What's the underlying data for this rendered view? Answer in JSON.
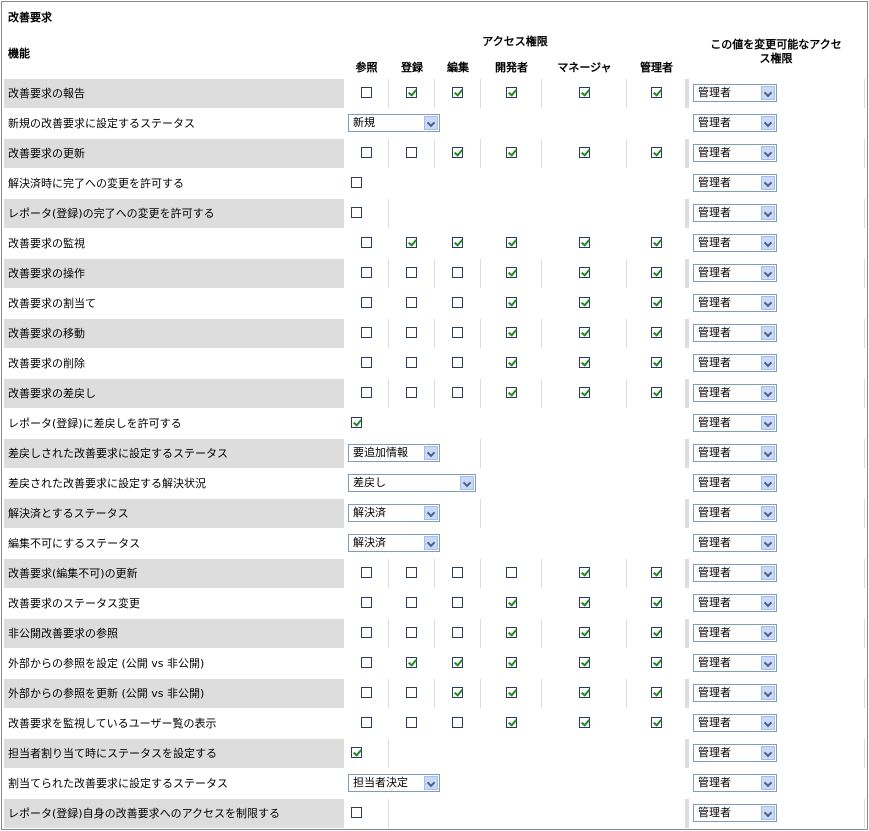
{
  "section_title": "改善要求",
  "headers": {
    "feature": "機能",
    "access": "アクセス権限",
    "change_line1": "この値を変更可能なアクセ",
    "change_line2": "ス権限",
    "roles": [
      "参照",
      "登録",
      "編集",
      "開発者",
      "マネージャ",
      "管理者"
    ]
  },
  "rows": [
    {
      "label": "改善要求の報告",
      "type": "checks",
      "checks": [
        false,
        true,
        true,
        true,
        true,
        true
      ],
      "change": "管理者"
    },
    {
      "label": "新規の改善要求に設定するステータス",
      "type": "select",
      "value": "新規",
      "change": "管理者"
    },
    {
      "label": "改善要求の更新",
      "type": "checks",
      "checks": [
        false,
        false,
        true,
        true,
        true,
        true
      ],
      "change": "管理者"
    },
    {
      "label": "解決済時に完了への変更を許可する",
      "type": "single",
      "checked": false,
      "change": "管理者"
    },
    {
      "label": "レポータ(登録)の完了への変更を許可する",
      "type": "single",
      "checked": false,
      "change": "管理者"
    },
    {
      "label": "改善要求の監視",
      "type": "checks",
      "checks": [
        false,
        true,
        true,
        true,
        true,
        true
      ],
      "change": "管理者"
    },
    {
      "label": "改善要求の操作",
      "type": "checks",
      "checks": [
        false,
        false,
        false,
        true,
        true,
        true
      ],
      "change": "管理者"
    },
    {
      "label": "改善要求の割当て",
      "type": "checks",
      "checks": [
        false,
        false,
        false,
        true,
        true,
        true
      ],
      "change": "管理者"
    },
    {
      "label": "改善要求の移動",
      "type": "checks",
      "checks": [
        false,
        false,
        false,
        true,
        true,
        true
      ],
      "change": "管理者"
    },
    {
      "label": "改善要求の削除",
      "type": "checks",
      "checks": [
        false,
        false,
        false,
        true,
        true,
        true
      ],
      "change": "管理者"
    },
    {
      "label": "改善要求の差戻し",
      "type": "checks",
      "checks": [
        false,
        false,
        false,
        true,
        true,
        true
      ],
      "change": "管理者"
    },
    {
      "label": "レポータ(登録)に差戻しを許可する",
      "type": "single",
      "checked": true,
      "change": "管理者"
    },
    {
      "label": "差戻しされた改善要求に設定するステータス",
      "type": "select",
      "value": "要追加情報",
      "change": "管理者"
    },
    {
      "label": "差戻された改善要求に設定する解決状況",
      "type": "select_wide",
      "value": "差戻し",
      "change": "管理者"
    },
    {
      "label": "解決済とするステータス",
      "type": "select",
      "value": "解決済",
      "change": "管理者"
    },
    {
      "label": "編集不可にするステータス",
      "type": "select",
      "value": "解決済",
      "change": "管理者"
    },
    {
      "label": "改善要求(編集不可)の更新",
      "type": "checks",
      "checks": [
        false,
        false,
        false,
        false,
        true,
        true
      ],
      "change": "管理者"
    },
    {
      "label": "改善要求のステータス変更",
      "type": "checks",
      "checks": [
        false,
        false,
        false,
        true,
        true,
        true
      ],
      "change": "管理者"
    },
    {
      "label": "非公開改善要求の参照",
      "type": "checks",
      "checks": [
        false,
        false,
        false,
        true,
        true,
        true
      ],
      "change": "管理者"
    },
    {
      "label": "外部からの参照を設定 (公開 vs 非公開)",
      "type": "checks",
      "checks": [
        false,
        true,
        true,
        true,
        true,
        true
      ],
      "change": "管理者"
    },
    {
      "label": "外部からの参照を更新 (公開 vs 非公開)",
      "type": "checks",
      "checks": [
        false,
        false,
        true,
        true,
        true,
        true
      ],
      "change": "管理者"
    },
    {
      "label": "改善要求を監視しているユーザー覧の表示",
      "type": "checks",
      "checks": [
        false,
        false,
        false,
        true,
        true,
        true
      ],
      "change": "管理者"
    },
    {
      "label": "担当者割り当て時にステータスを設定する",
      "type": "single",
      "checked": true,
      "change": "管理者"
    },
    {
      "label": "割当てられた改善要求に設定するステータス",
      "type": "select",
      "value": "担当者決定",
      "change": "管理者"
    },
    {
      "label": "レポータ(登録)自身の改善要求へのアクセスを制限する",
      "type": "single",
      "checked": false,
      "change": "管理者"
    }
  ]
}
